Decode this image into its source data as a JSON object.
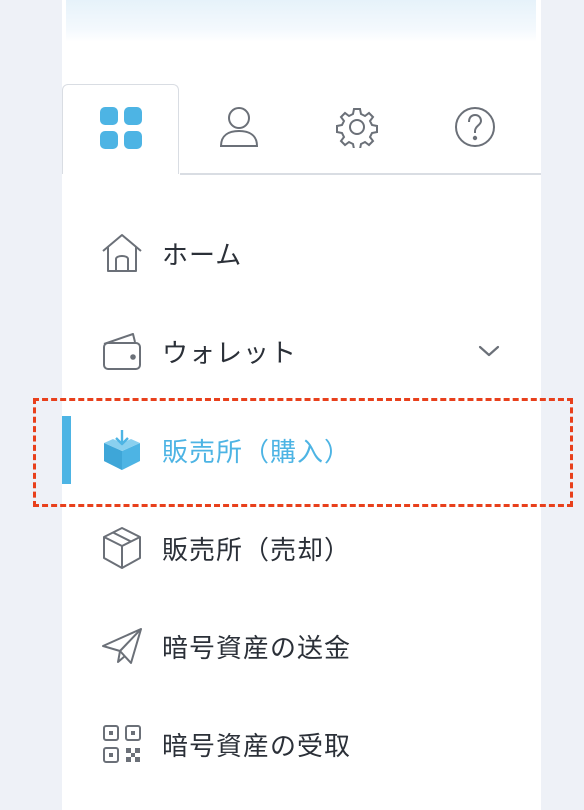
{
  "tabs": [
    {
      "id": "dashboard",
      "icon": "grid-icon",
      "active": true
    },
    {
      "id": "account",
      "icon": "user-icon",
      "active": false
    },
    {
      "id": "settings",
      "icon": "gear-icon",
      "active": false
    },
    {
      "id": "help",
      "icon": "question-icon",
      "active": false
    }
  ],
  "menu": {
    "home": {
      "label": "ホーム",
      "icon": "home-icon"
    },
    "wallet": {
      "label": "ウォレット",
      "icon": "wallet-icon"
    },
    "buy": {
      "label": "販売所（購入）",
      "icon": "box-download-icon",
      "active": true
    },
    "sell": {
      "label": "販売所（売却）",
      "icon": "box-outline-icon"
    },
    "send": {
      "label": "暗号資産の送金",
      "icon": "paper-plane-icon"
    },
    "receive": {
      "label": "暗号資産の受取",
      "icon": "qr-code-icon"
    }
  },
  "colors": {
    "accent": "#4db4e4",
    "highlight": "#e8401c",
    "text": "#2b3038",
    "icon_stroke": "#6b7078"
  }
}
